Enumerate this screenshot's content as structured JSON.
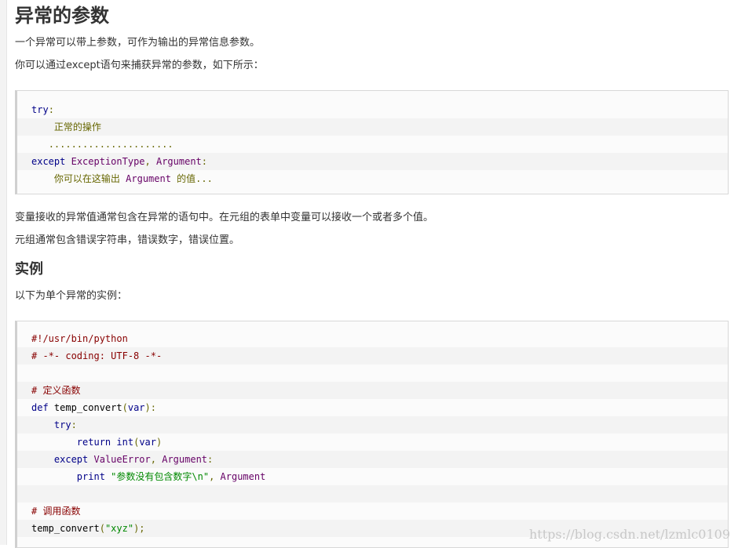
{
  "title": "异常的参数",
  "intro": [
    "一个异常可以带上参数，可作为输出的异常信息参数。",
    "你可以通过except语句来捕获异常的参数，如下所示："
  ],
  "code1": [
    [
      [
        "kw",
        "try"
      ],
      [
        "pun",
        ":"
      ]
    ],
    [
      [
        "pln",
        "    "
      ],
      [
        "txt",
        "正常的操作"
      ]
    ],
    [
      [
        "pln",
        "   "
      ],
      [
        "pun",
        "......................"
      ]
    ],
    [
      [
        "kw",
        "except"
      ],
      [
        "pln",
        " "
      ],
      [
        "cls",
        "ExceptionType"
      ],
      [
        "pun",
        ","
      ],
      [
        "pln",
        " "
      ],
      [
        "cls",
        "Argument"
      ],
      [
        "pun",
        ":"
      ]
    ],
    [
      [
        "pln",
        "    "
      ],
      [
        "txt",
        "你可以在这输出 "
      ],
      [
        "cls",
        "Argument"
      ],
      [
        "txt",
        " 的值..."
      ]
    ]
  ],
  "middle": [
    "变量接收的异常值通常包含在异常的语句中。在元组的表单中变量可以接收一个或者多个值。",
    "元组通常包含错误字符串，错误数字，错误位置。"
  ],
  "example_heading": "实例",
  "example_intro": "以下为单个异常的实例：",
  "code2": [
    [
      [
        "com",
        "#!/usr/bin/python"
      ]
    ],
    [
      [
        "com",
        "# -*- coding: UTF-8 -*-"
      ]
    ],
    [
      [
        "pln",
        ""
      ]
    ],
    [
      [
        "com",
        "# 定义函数"
      ]
    ],
    [
      [
        "kw",
        "def"
      ],
      [
        "pln",
        " temp_convert"
      ],
      [
        "pun",
        "("
      ],
      [
        "kw",
        "var"
      ],
      [
        "pun",
        "):"
      ]
    ],
    [
      [
        "pln",
        "    "
      ],
      [
        "kw",
        "try"
      ],
      [
        "pun",
        ":"
      ]
    ],
    [
      [
        "pln",
        "        "
      ],
      [
        "kw",
        "return"
      ],
      [
        "pln",
        " "
      ],
      [
        "kw",
        "int"
      ],
      [
        "pun",
        "("
      ],
      [
        "kw",
        "var"
      ],
      [
        "pun",
        ")"
      ]
    ],
    [
      [
        "pln",
        "    "
      ],
      [
        "kw",
        "except"
      ],
      [
        "pln",
        " "
      ],
      [
        "cls",
        "ValueError"
      ],
      [
        "pun",
        ","
      ],
      [
        "pln",
        " "
      ],
      [
        "cls",
        "Argument"
      ],
      [
        "pun",
        ":"
      ]
    ],
    [
      [
        "pln",
        "        "
      ],
      [
        "kw",
        "print"
      ],
      [
        "pln",
        " "
      ],
      [
        "str",
        "\"参数没有包含数字\\n\""
      ],
      [
        "pun",
        ","
      ],
      [
        "pln",
        " "
      ],
      [
        "cls",
        "Argument"
      ]
    ],
    [
      [
        "pln",
        ""
      ]
    ],
    [
      [
        "com",
        "# 调用函数"
      ]
    ],
    [
      [
        "pln",
        "temp_convert"
      ],
      [
        "pun",
        "("
      ],
      [
        "str",
        "\"xyz\""
      ],
      [
        "pun",
        ");"
      ]
    ]
  ],
  "watermark": "https://blog.csdn.net/lzmlc0109"
}
